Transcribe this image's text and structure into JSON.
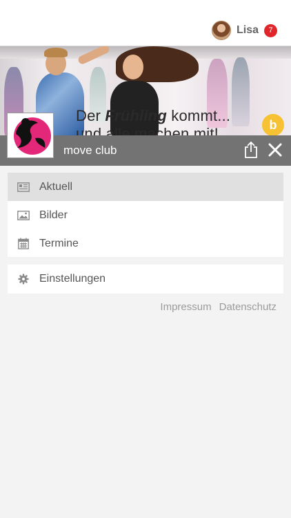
{
  "header": {
    "user_name": "Lisa",
    "notification_count": "7"
  },
  "banner": {
    "text_part1": "Der ",
    "text_bold": "Frühling",
    "text_part2": " kommt...",
    "text_line2": "und alle machen mit!",
    "logo_letter": "b"
  },
  "club": {
    "name": "move club"
  },
  "menu": {
    "items": [
      {
        "label": "Aktuell",
        "icon": "newspaper-icon",
        "active": true
      },
      {
        "label": "Bilder",
        "icon": "image-icon",
        "active": false
      },
      {
        "label": "Termine",
        "icon": "calendar-icon",
        "active": false
      }
    ],
    "settings_label": "Einstellungen"
  },
  "footer": {
    "impressum": "Impressum",
    "datenschutz": "Datenschutz"
  },
  "colors": {
    "club_bar": "#737373",
    "badge": "#e0262b",
    "active_item": "#e0e0e0",
    "logo_pink": "#e3287a"
  }
}
